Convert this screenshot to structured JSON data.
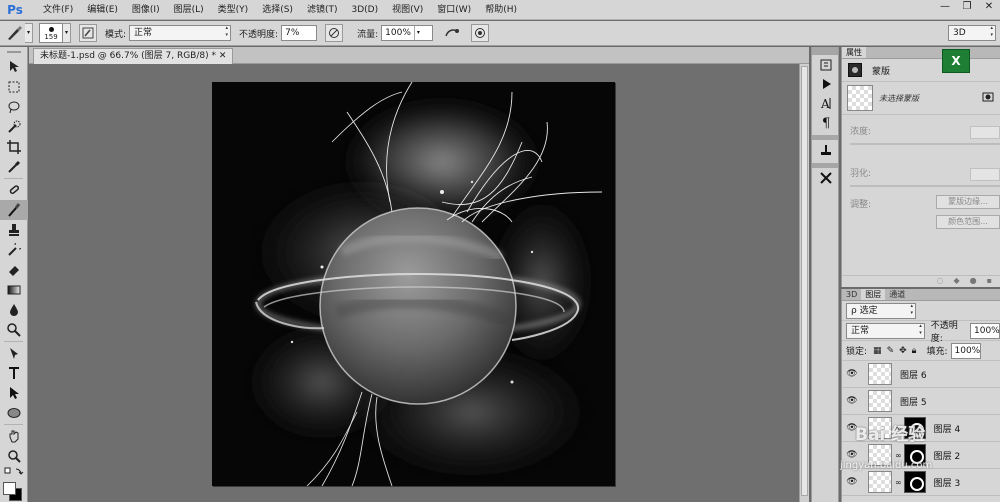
{
  "app": {
    "logo": "Ps"
  },
  "menu": [
    "文件(F)",
    "编辑(E)",
    "图像(I)",
    "图层(L)",
    "类型(Y)",
    "选择(S)",
    "滤镜(T)",
    "3D(D)",
    "视图(V)",
    "窗口(W)",
    "帮助(H)"
  ],
  "window_controls": {
    "minimize": "—",
    "restore": "❐",
    "close": "✕"
  },
  "options": {
    "brush_size": "159",
    "mode_label": "模式:",
    "mode_value": "正常",
    "opacity_label": "不透明度:",
    "opacity_value": "7%",
    "flow_label": "流量:",
    "flow_value": "100%",
    "workspace_value": "3D"
  },
  "document": {
    "tab_title": "未标题-1.psd @ 66.7% (图层 7, RGB/8) *"
  },
  "colors": {
    "foreground": "#ffffff",
    "background": "#000000",
    "excel": "#1e7e34"
  },
  "excel_icon": "X",
  "properties": {
    "tab": "属性",
    "title": "蒙版",
    "no_selection": "未选择蒙版",
    "density_label": "浓度:",
    "feather_label": "羽化:",
    "adjust_label": "调整:",
    "mask_edge_button": "蒙版边缘...",
    "color_range_button": "颜色范围..."
  },
  "layers_panel": {
    "tabs": [
      "3D",
      "图层",
      "通道"
    ],
    "kind_filter": "ρ 选定",
    "blend_mode": "正常",
    "opacity_label": "不透明度:",
    "opacity_value": "100%",
    "lock_label": "锁定:",
    "fill_label": "填充:",
    "fill_value": "100%",
    "layers": [
      {
        "name": "图层 6"
      },
      {
        "name": "图层 5"
      },
      {
        "name": "图层 4"
      },
      {
        "name": "图层 2"
      },
      {
        "name": "图层 3"
      }
    ]
  },
  "watermark": {
    "main": "Bai 经验",
    "sub": "jingyan.baidu.com"
  }
}
